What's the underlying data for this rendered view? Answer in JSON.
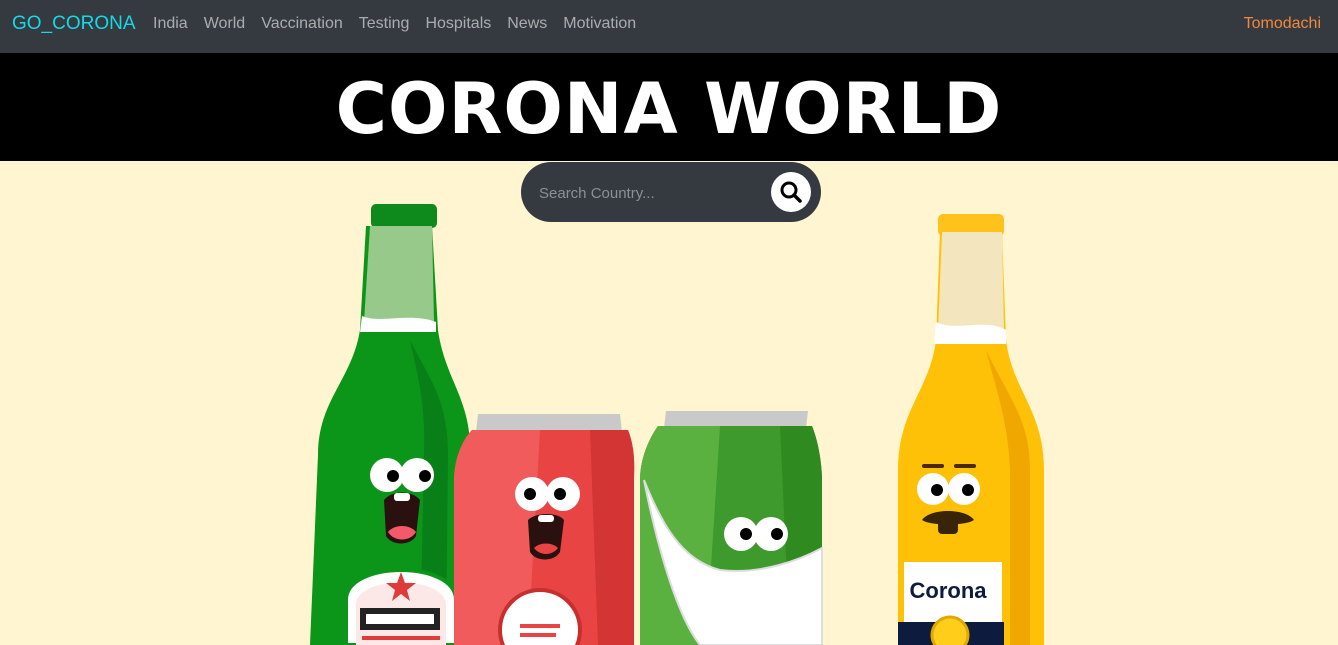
{
  "navbar": {
    "brand": "GO_CORONA",
    "links": [
      "India",
      "World",
      "Vaccination",
      "Testing",
      "Hospitals",
      "News",
      "Motivation"
    ],
    "right_link": "Tomodachi"
  },
  "hero": {
    "title": "CORONA WORLD"
  },
  "search": {
    "placeholder": "Search Country..."
  },
  "illustration": {
    "label_text": "Corona"
  },
  "colors": {
    "navbar_bg": "#343a40",
    "brand": "#17d9e6",
    "right_link": "#f0883e",
    "hero_bg": "#000000",
    "page_bg": "#fff5d1"
  }
}
